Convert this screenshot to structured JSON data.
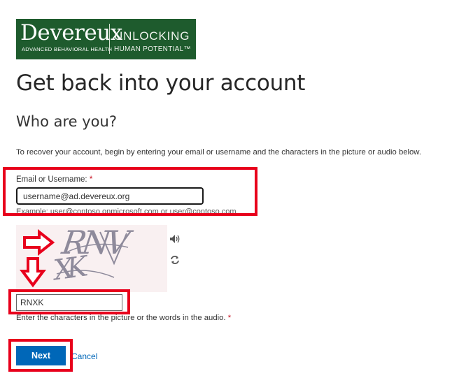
{
  "logo": {
    "brand": "Devereux",
    "brand_sub": "ADVANCED BEHAVIORAL HEALTH",
    "tagline_1": "UNLOCKING",
    "tagline_2": "HUMAN POTENTIAL™"
  },
  "page_title": "Get back into your account",
  "section_title": "Who are you?",
  "instructions": "To recover your account, begin by entering your email or username and the characters in the picture or audio below.",
  "email": {
    "label": "Email or Username:",
    "required_marker": "*",
    "value": "username@ad.devereux.org",
    "example": "Example: user@contoso.onmicrosoft.com or user@contoso.com"
  },
  "captcha": {
    "image_text_line_1": "RNV",
    "image_text_line_2": "XK",
    "input_value": "RNXK",
    "hint": "Enter the characters in the picture or the words in the audio.",
    "required_marker": "*",
    "audio_icon": "speaker-icon",
    "refresh_icon": "refresh-icon"
  },
  "actions": {
    "next_label": "Next",
    "cancel_label": "Cancel"
  },
  "colors": {
    "logo_bg": "#1e5b2d",
    "accent_blue": "#0067b8",
    "annotation_red": "#e8001c"
  }
}
